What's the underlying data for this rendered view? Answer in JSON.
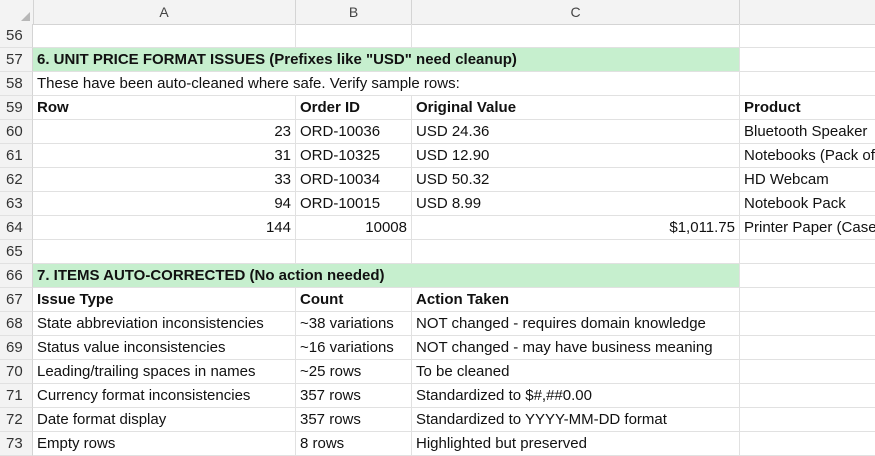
{
  "columns": [
    "A",
    "B",
    "C"
  ],
  "rows": {
    "r56": {
      "num": "56"
    },
    "r57": {
      "num": "57",
      "a": "6. UNIT PRICE FORMAT ISSUES (Prefixes like \"USD\" need cleanup)"
    },
    "r58": {
      "num": "58",
      "a": "These have been auto-cleaned where safe. Verify sample rows:"
    },
    "r59": {
      "num": "59",
      "a": "Row",
      "b": "Order ID",
      "c": "Original Value",
      "d": "Product"
    },
    "r60": {
      "num": "60",
      "a": "23",
      "b": "ORD-10036",
      "c": "USD 24.36",
      "d": "Bluetooth Speaker"
    },
    "r61": {
      "num": "61",
      "a": "31",
      "b": "ORD-10325",
      "c": "USD 12.90",
      "d": "Notebooks (Pack of"
    },
    "r62": {
      "num": "62",
      "a": "33",
      "b": "ORD-10034",
      "c": "USD 50.32",
      "d": "HD Webcam"
    },
    "r63": {
      "num": "63",
      "a": "94",
      "b": "ORD-10015",
      "c": "USD 8.99",
      "d": "Notebook Pack"
    },
    "r64": {
      "num": "64",
      "a": "144",
      "b": "10008",
      "c": "$1,011.75",
      "d": "Printer Paper (Case"
    },
    "r65": {
      "num": "65"
    },
    "r66": {
      "num": "66",
      "a": "7. ITEMS AUTO-CORRECTED (No action needed)"
    },
    "r67": {
      "num": "67",
      "a": "Issue Type",
      "b": "Count",
      "c": "Action Taken"
    },
    "r68": {
      "num": "68",
      "a": "State abbreviation inconsistencies",
      "b": "~38 variations",
      "c": "NOT changed - requires domain knowledge"
    },
    "r69": {
      "num": "69",
      "a": "Status value inconsistencies",
      "b": "~16 variations",
      "c": "NOT changed - may have business meaning"
    },
    "r70": {
      "num": "70",
      "a": "Leading/trailing spaces in names",
      "b": "~25 rows",
      "c": "To be cleaned"
    },
    "r71": {
      "num": "71",
      "a": "Currency format inconsistencies",
      "b": "357 rows",
      "c": "Standardized to $#,##0.00"
    },
    "r72": {
      "num": "72",
      "a": "Date format display",
      "b": "357 rows",
      "c": "Standardized to YYYY-MM-DD format"
    },
    "r73": {
      "num": "73",
      "a": "Empty rows",
      "b": "8 rows",
      "c": "Highlighted but preserved"
    }
  },
  "colors": {
    "section_header_fill": "#c6efce",
    "header_bg": "#f3f3f3",
    "grid": "#e1e1e1"
  }
}
